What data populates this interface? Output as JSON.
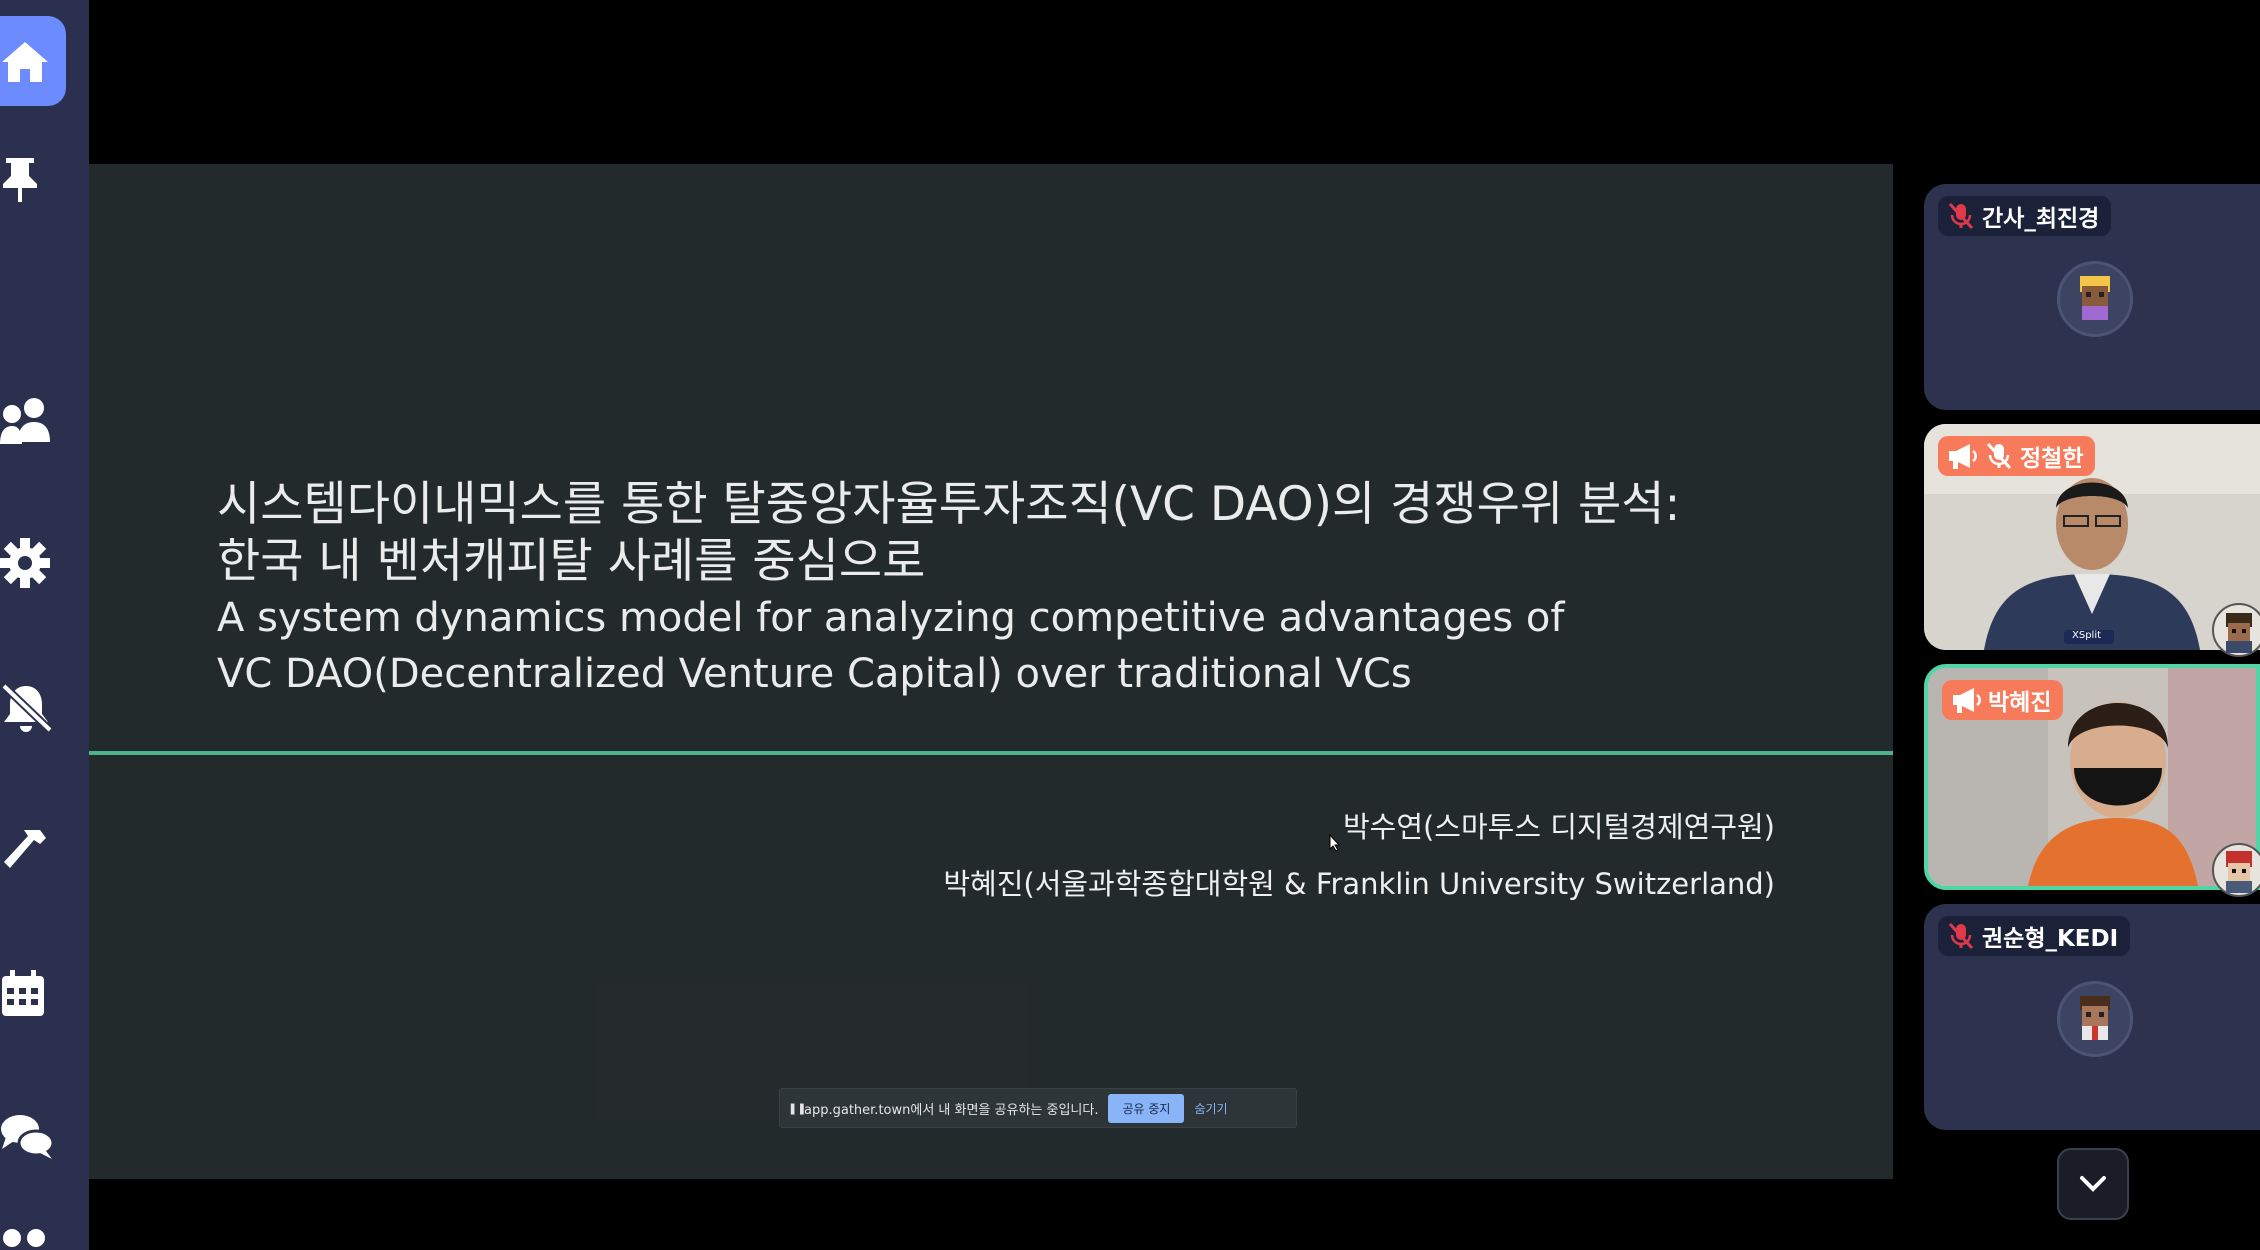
{
  "slide": {
    "title_ko_line1": "시스템다이내믹스를 통한 탈중앙자율투자조직(VC DAO)의 경쟁우위 분석:",
    "title_ko_line2": "한국 내 벤처캐피탈 사례를 중심으로",
    "title_en_line1": "A system dynamics model for analyzing competitive advantages of",
    "title_en_line2": "VC DAO(Decentralized Venture Capital) over traditional VCs",
    "author1": "박수연(스마투스 디지털경제연구원)",
    "author2": "박혜진(서울과학종합대학원 & Franklin University Switzerland)"
  },
  "share_bar": {
    "pause_icon": "pause-icon",
    "message": "app.gather.town에서 내 화면을 공유하는 중입니다.",
    "stop_label": "공유 중지",
    "hide_label": "숨기기"
  },
  "participants": [
    {
      "name": "간사_최진경",
      "muted": true,
      "speaking": false
    },
    {
      "name": "정철한",
      "muted": true,
      "speaking": true
    },
    {
      "name": "박혜진",
      "muted": false,
      "speaking": true
    },
    {
      "name": "권순형_KEDI",
      "muted": true,
      "speaking": false
    }
  ],
  "sidebar": {
    "items": [
      "home-icon",
      "pin-icon",
      "people-icon",
      "gear-icon",
      "bell-off-icon",
      "hammer-icon",
      "calendar-icon",
      "chat-icon",
      "more-icon"
    ]
  },
  "colors": {
    "sidebar": "#2a304d",
    "accent": "#6c8bff",
    "slide_bg": "#232a2c",
    "divider": "#4fb38a",
    "speaking_tag": "#f77a5b",
    "active_border": "#4fd6a4"
  },
  "video_watermark": "XSplit"
}
